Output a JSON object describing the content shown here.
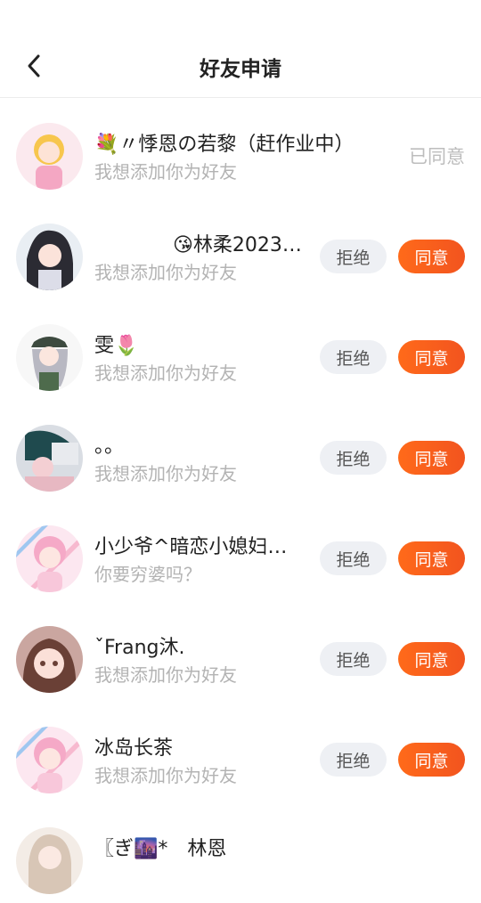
{
  "header": {
    "title": "好友申请"
  },
  "buttons": {
    "reject": "拒绝",
    "accept": "同意",
    "accepted": "已同意"
  },
  "requests": [
    {
      "name": "💐〃悸恩の若黎（赶作业中）",
      "message": "我想添加你为好友",
      "status": "accepted"
    },
    {
      "name": "　　　　😘林柔2023…",
      "message": "我想添加你为好友",
      "status": "pending"
    },
    {
      "name": "雯🌷",
      "message": "我想添加你为好友",
      "status": "pending"
    },
    {
      "name": "。。",
      "message": "我想添加你为好友",
      "status": "pending"
    },
    {
      "name": "小少爷^暗恋小媳妇…",
      "message": "你要穷婆吗？",
      "status": "pending"
    },
    {
      "name": "ˇFrang沐.",
      "message": "我想添加你为好友",
      "status": "pending"
    },
    {
      "name": "冰岛长茶",
      "message": "我想添加你为好友",
      "status": "pending"
    },
    {
      "name": "〖ぎ🌆*　林恩",
      "message": "",
      "status": "pending"
    }
  ]
}
